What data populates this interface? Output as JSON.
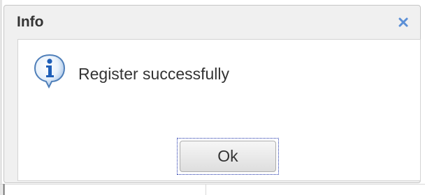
{
  "dialog": {
    "title": "Info",
    "close_icon": "close-icon",
    "message": "Register successfully",
    "message_icon": "info-icon",
    "ok_label": "Ok"
  },
  "colors": {
    "title_text": "#343434",
    "close_icon": "#5b8fd6",
    "info_icon_blue": "#1f5fb8"
  }
}
